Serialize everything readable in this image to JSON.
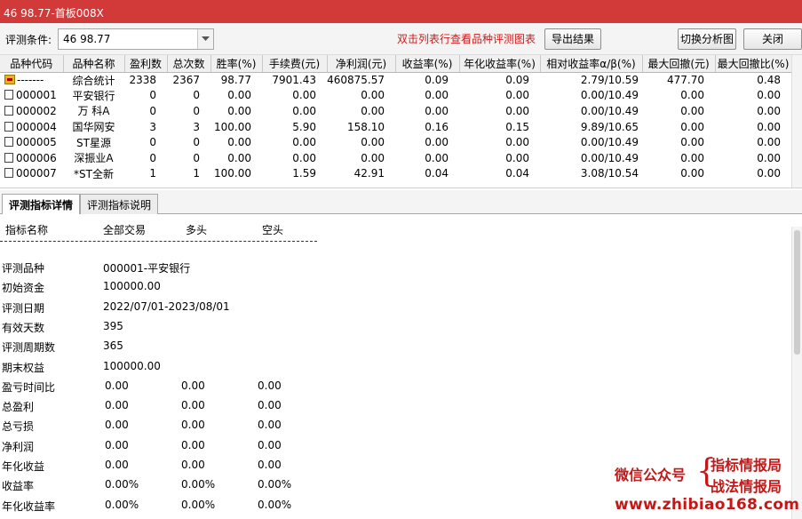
{
  "window": {
    "title": "46  98.77-首板008X"
  },
  "toolbar": {
    "condition_label": "评测条件:",
    "condition_value": "46  98.77",
    "hint": "双击列表行查看品种评测图表",
    "export_label": "导出结果",
    "switch_label": "切换分析图",
    "close_label": "关闭"
  },
  "grid": {
    "columns": [
      "品种代码",
      "品种名称",
      "盈利数",
      "总次数",
      "胜率(%)",
      "手续费(元)",
      "净利润(元)",
      "收益率(%)",
      "年化收益率(%)",
      "相对收益率α/β(%)",
      "最大回撤(元)",
      "最大回撤比(%)"
    ],
    "rows": [
      [
        "-------",
        "综合统计",
        "2338",
        "2367",
        "98.77",
        "7901.43",
        "460875.57",
        "0.09",
        "0.09",
        "2.79/10.59",
        "477.70",
        "0.48"
      ],
      [
        "000001",
        "平安银行",
        "0",
        "0",
        "0.00",
        "0.00",
        "0.00",
        "0.00",
        "0.00",
        "0.00/10.49",
        "0.00",
        "0.00"
      ],
      [
        "000002",
        "万 科A",
        "0",
        "0",
        "0.00",
        "0.00",
        "0.00",
        "0.00",
        "0.00",
        "0.00/10.49",
        "0.00",
        "0.00"
      ],
      [
        "000004",
        "国华网安",
        "3",
        "3",
        "100.00",
        "5.90",
        "158.10",
        "0.16",
        "0.15",
        "9.89/10.65",
        "0.00",
        "0.00"
      ],
      [
        "000005",
        "ST星源",
        "0",
        "0",
        "0.00",
        "0.00",
        "0.00",
        "0.00",
        "0.00",
        "0.00/10.49",
        "0.00",
        "0.00"
      ],
      [
        "000006",
        "深振业A",
        "0",
        "0",
        "0.00",
        "0.00",
        "0.00",
        "0.00",
        "0.00",
        "0.00/10.49",
        "0.00",
        "0.00"
      ],
      [
        "000007",
        "*ST全新",
        "1",
        "1",
        "100.00",
        "1.59",
        "42.91",
        "0.04",
        "0.04",
        "3.08/10.54",
        "0.00",
        "0.00"
      ]
    ]
  },
  "tabs": [
    "评测指标详情",
    "评测指标说明"
  ],
  "detail": {
    "headers": [
      "指标名称",
      "全部交易",
      "多头",
      "空头"
    ],
    "rows": [
      {
        "name": "评测品种",
        "all": "000001-平安银行",
        "long": "",
        "short": ""
      },
      {
        "name": "初始资金",
        "all": "100000.00",
        "long": "",
        "short": ""
      },
      {
        "name": "评测日期",
        "all": "2022/07/01-2023/08/01",
        "long": "",
        "short": ""
      },
      {
        "name": "有效天数",
        "all": "395",
        "long": "",
        "short": ""
      },
      {
        "name": "评测周期数",
        "all": "365",
        "long": "",
        "short": ""
      },
      {
        "name": "期末权益",
        "all": "100000.00",
        "long": "",
        "short": ""
      },
      {
        "name": "盈亏时间比",
        "all": "0.00",
        "long": "0.00",
        "short": "0.00"
      },
      {
        "name": "总盈利",
        "all": "0.00",
        "long": "0.00",
        "short": "0.00"
      },
      {
        "name": "总亏损",
        "all": "0.00",
        "long": "0.00",
        "short": "0.00"
      },
      {
        "name": "净利润",
        "all": "0.00",
        "long": "0.00",
        "short": "0.00"
      },
      {
        "name": "年化收益",
        "all": "0.00",
        "long": "0.00",
        "short": "0.00"
      },
      {
        "name": "收益率",
        "all": "0.00%",
        "long": "0.00%",
        "short": "0.00%"
      },
      {
        "name": "年化收益率",
        "all": "0.00%",
        "long": "0.00%",
        "short": "0.00%"
      }
    ]
  },
  "watermark": {
    "line1": "微信公众号",
    "line2": "指标情报局",
    "line3": "战法情报局",
    "url": "www.zhibiao168.com"
  }
}
